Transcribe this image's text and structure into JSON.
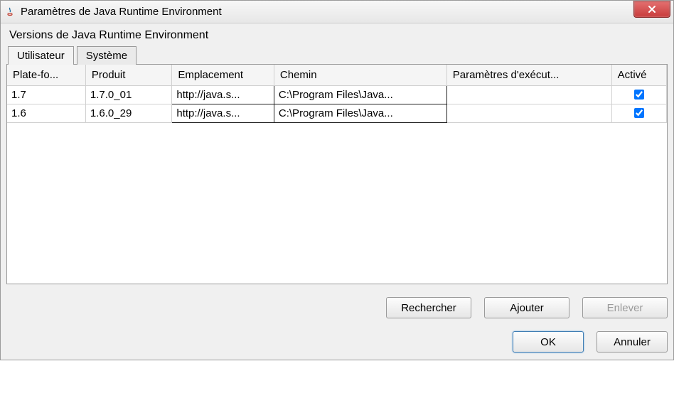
{
  "window": {
    "title": "Paramètres de Java Runtime Environment"
  },
  "section": {
    "label": "Versions de Java Runtime Environment"
  },
  "tabs": {
    "user": "Utilisateur",
    "system": "Système"
  },
  "columns": {
    "platform": "Plate-fo...",
    "product": "Produit",
    "location": "Emplacement",
    "path": "Chemin",
    "args": "Paramètres d'exécut...",
    "enabled": "Activé"
  },
  "rows": [
    {
      "platform": "1.7",
      "product": "1.7.0_01",
      "location": "http://java.s...",
      "path": "C:\\Program Files\\Java...",
      "args": "",
      "enabled": true
    },
    {
      "platform": "1.6",
      "product": "1.6.0_29",
      "location": "http://java.s...",
      "path": "C:\\Program Files\\Java...",
      "args": "",
      "enabled": true
    }
  ],
  "buttons": {
    "search": "Rechercher",
    "add": "Ajouter",
    "remove": "Enlever",
    "ok": "OK",
    "cancel": "Annuler"
  }
}
